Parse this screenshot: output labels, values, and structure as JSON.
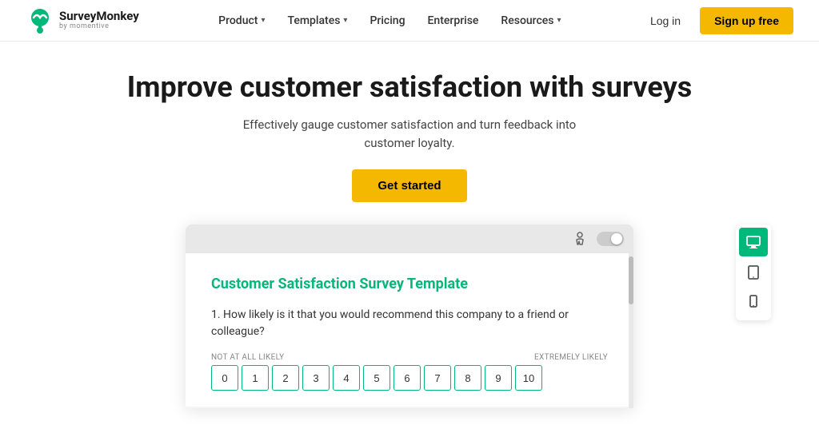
{
  "nav": {
    "logo_alt": "SurveyMonkey by Momentive",
    "links": [
      {
        "label": "Product",
        "has_dropdown": true
      },
      {
        "label": "Templates",
        "has_dropdown": true
      },
      {
        "label": "Pricing",
        "has_dropdown": false
      },
      {
        "label": "Enterprise",
        "has_dropdown": false
      },
      {
        "label": "Resources",
        "has_dropdown": true
      }
    ],
    "log_in": "Log in",
    "sign_up": "Sign up free"
  },
  "hero": {
    "heading": "Improve customer satisfaction with surveys",
    "subheading": "Effectively gauge customer satisfaction and turn feedback into customer loyalty.",
    "cta": "Get started"
  },
  "demo": {
    "survey_title": "Customer Satisfaction Survey Template",
    "question": "1. How likely is it that you would recommend this company to a friend or colleague?",
    "scale_label_left": "NOT AT ALL LIKELY",
    "scale_label_right": "EXTREMELY LIKELY",
    "scale_numbers": [
      "0",
      "1",
      "2",
      "3",
      "4",
      "5",
      "6",
      "7",
      "8",
      "9",
      "10"
    ]
  },
  "side_icons": {
    "desktop_label": "desktop",
    "tablet_label": "tablet",
    "mobile_label": "mobile"
  },
  "colors": {
    "green": "#00b87a",
    "yellow": "#f5b800"
  }
}
